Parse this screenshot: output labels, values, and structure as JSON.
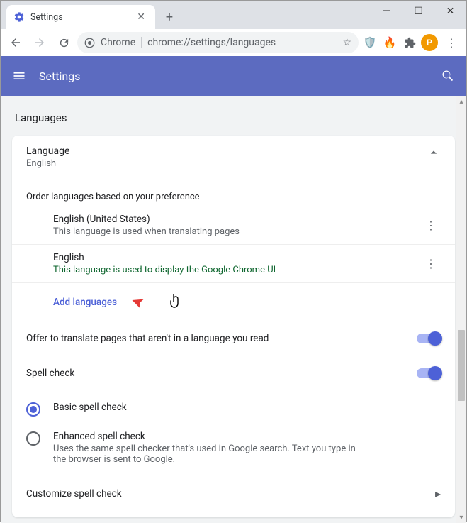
{
  "window": {
    "tab_title": "Settings",
    "address_label": "Chrome",
    "address_url": "chrome://settings/languages",
    "avatar_letter": "P"
  },
  "header": {
    "title": "Settings"
  },
  "page": {
    "section": "Languages",
    "language_card": {
      "title": "Language",
      "value": "English"
    },
    "order_instruction": "Order languages based on your preference",
    "languages": [
      {
        "name": "English (United States)",
        "desc": "This language is used when translating pages",
        "desc_class": "grey"
      },
      {
        "name": "English",
        "desc": "This language is used to display the Google Chrome UI",
        "desc_class": "green"
      }
    ],
    "add_languages": "Add languages",
    "translate_offer": "Offer to translate pages that aren't in a language you read",
    "spellcheck_label": "Spell check",
    "spell_options": {
      "basic": {
        "label": "Basic spell check"
      },
      "enhanced": {
        "label": "Enhanced spell check",
        "desc": "Uses the same spell checker that's used in Google search. Text you type in the browser is sent to Google."
      }
    },
    "customize": "Customize spell check"
  },
  "toggles": {
    "translate": true,
    "spellcheck": true
  }
}
